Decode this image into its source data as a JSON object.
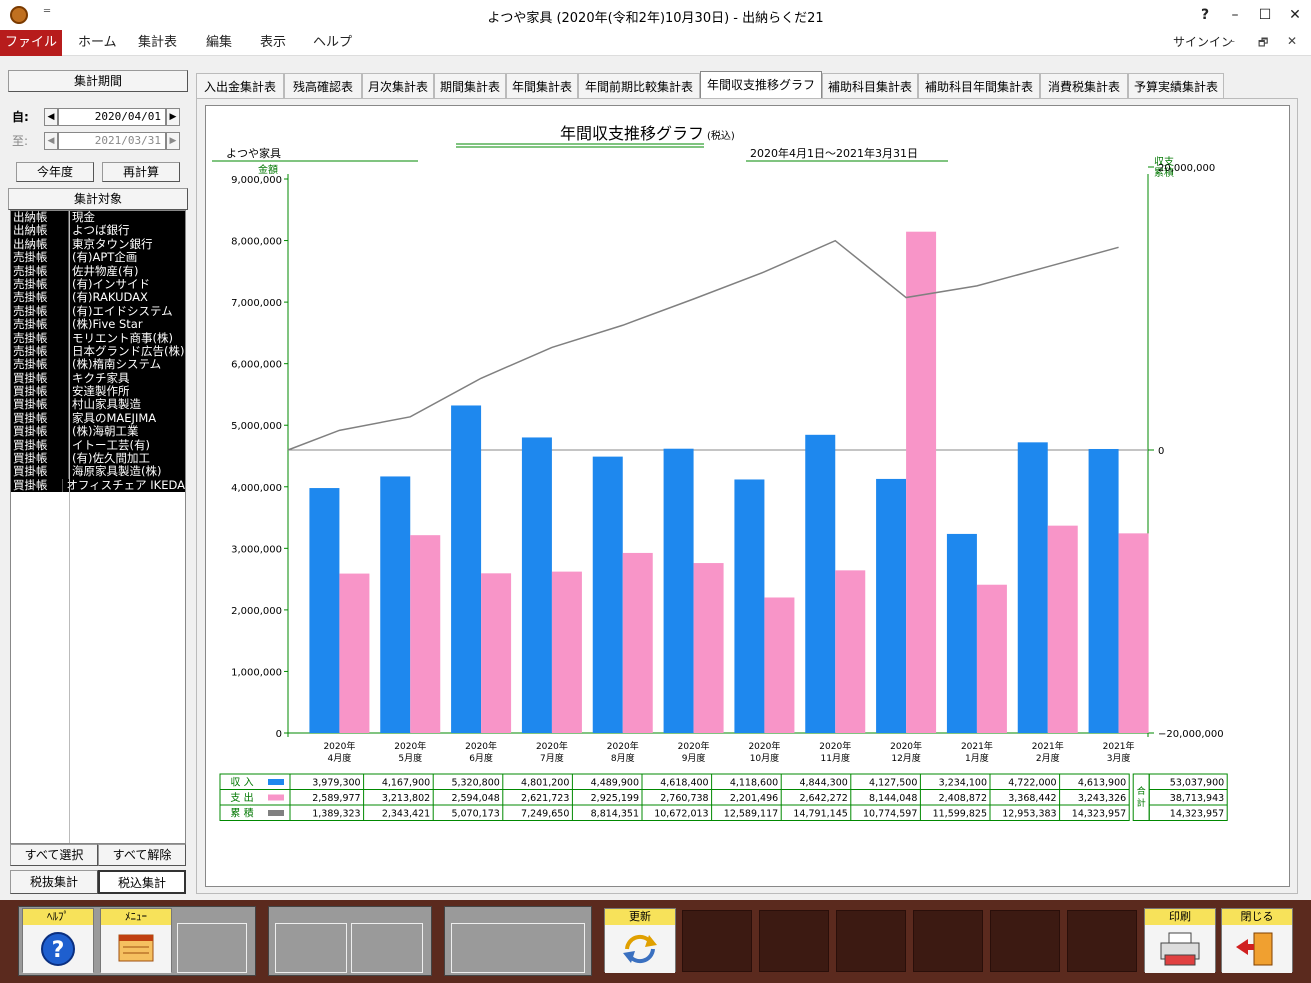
{
  "window": {
    "title": "よつや家具 (2020年(令和2年)10月30日) - 出納らくだ21",
    "qa": "═",
    "help": "?",
    "minimize": "–",
    "maximize": "☐",
    "close": "✕"
  },
  "menu": {
    "file": "ファイル",
    "items": [
      "ホーム",
      "集計表",
      "編集",
      "表示",
      "ヘルプ"
    ],
    "signin": "サインイン",
    "sub_min": "–",
    "sub_restore": "🗗",
    "sub_close": "✕"
  },
  "left": {
    "period_header": "集計期間",
    "from_label": "自:",
    "to_label": "至:",
    "from": "2020/04/01",
    "to": "2021/03/31",
    "this_year": "今年度",
    "recalc": "再計算",
    "target_header": "集計対象",
    "select_all": "すべて選択",
    "deselect_all": "すべて解除",
    "tax_excl": "税抜集計",
    "tax_incl": "税込集計",
    "targets": [
      [
        "出納帳",
        "現金"
      ],
      [
        "出納帳",
        "よつば銀行"
      ],
      [
        "出納帳",
        "東京タウン銀行"
      ],
      [
        "売掛帳",
        "(有)APT企画"
      ],
      [
        "売掛帳",
        "佐井物産(有)"
      ],
      [
        "売掛帳",
        "(有)インサイド"
      ],
      [
        "売掛帳",
        "(有)RAKUDAX"
      ],
      [
        "売掛帳",
        "(有)エイドシステム"
      ],
      [
        "売掛帳",
        "(株)Five Star"
      ],
      [
        "売掛帳",
        "モリエント商事(株)"
      ],
      [
        "売掛帳",
        "日本グランド広告(株)"
      ],
      [
        "売掛帳",
        "(株)楕南システム"
      ],
      [
        "買掛帳",
        "キクチ家具"
      ],
      [
        "買掛帳",
        "安達製作所"
      ],
      [
        "買掛帳",
        "村山家具製造"
      ],
      [
        "買掛帳",
        "家具のMAEJIMA"
      ],
      [
        "買掛帳",
        "(株)海朝工業"
      ],
      [
        "買掛帳",
        "イトー工芸(有)"
      ],
      [
        "買掛帳",
        "(有)佐久間加工"
      ],
      [
        "買掛帳",
        "海原家具製造(株)"
      ],
      [
        "買掛帳",
        "オフィスチェア IKEDA"
      ]
    ]
  },
  "tabs": [
    "入出金集計表",
    "残高確認表",
    "月次集計表",
    "期間集計表",
    "年間集計表",
    "年間前期比較集計表",
    "年間収支推移グラフ",
    "補助科目集計表",
    "補助科目年間集計表",
    "消費税集計表",
    "予算実績集計表"
  ],
  "active_tab": 6,
  "chart_data": {
    "type": "bar",
    "title": "年間収支推移グラフ",
    "title_note": "(税込)",
    "company": "よつや家具",
    "period": "2020年4月1日～2021年3月31日",
    "ylabel_left": "金額",
    "ylabel_right": [
      "収支",
      "累積"
    ],
    "ylim_left": [
      0,
      9000000
    ],
    "ylim_right": [
      -20000000,
      20000000
    ],
    "yticks_left": [
      "0",
      "1,000,000",
      "2,000,000",
      "3,000,000",
      "4,000,000",
      "5,000,000",
      "6,000,000",
      "7,000,000",
      "8,000,000",
      "9,000,000"
    ],
    "yticks_right": [
      "−20,000,000",
      "0",
      "20,000,000"
    ],
    "categories": [
      [
        "2020年",
        "4月度"
      ],
      [
        "2020年",
        "5月度"
      ],
      [
        "2020年",
        "6月度"
      ],
      [
        "2020年",
        "7月度"
      ],
      [
        "2020年",
        "8月度"
      ],
      [
        "2020年",
        "9月度"
      ],
      [
        "2020年",
        "10月度"
      ],
      [
        "2020年",
        "11月度"
      ],
      [
        "2020年",
        "12月度"
      ],
      [
        "2021年",
        "1月度"
      ],
      [
        "2021年",
        "2月度"
      ],
      [
        "2021年",
        "3月度"
      ]
    ],
    "series": [
      {
        "name": "収 入",
        "color": "#1e88ee",
        "values": [
          3979300,
          4167900,
          5320800,
          4801200,
          4489900,
          4618400,
          4118600,
          4844300,
          4127500,
          3234100,
          4722000,
          4613900
        ],
        "total": "53,037,900",
        "labels": [
          "3,979,300",
          "4,167,900",
          "5,320,800",
          "4,801,200",
          "4,489,900",
          "4,618,400",
          "4,118,600",
          "4,844,300",
          "4,127,500",
          "3,234,100",
          "4,722,000",
          "4,613,900"
        ]
      },
      {
        "name": "支 出",
        "color": "#f895c8",
        "values": [
          2589977,
          3213802,
          2594048,
          2621723,
          2925199,
          2760738,
          2201496,
          2642272,
          8144048,
          2408872,
          3368442,
          3243326
        ],
        "total": "38,713,943",
        "labels": [
          "2,589,977",
          "3,213,802",
          "2,594,048",
          "2,621,723",
          "2,925,199",
          "2,760,738",
          "2,201,496",
          "2,642,272",
          "8,144,048",
          "2,408,872",
          "3,368,442",
          "3,243,326"
        ]
      },
      {
        "name": "累 積",
        "color": "#808080",
        "values": [
          1389323,
          2343421,
          5070173,
          7249650,
          8814351,
          10672013,
          12589117,
          14791145,
          10774597,
          11599825,
          12953383,
          14323957
        ],
        "total": "14,323,957",
        "labels": [
          "1,389,323",
          "2,343,421",
          "5,070,173",
          "7,249,650",
          "8,814,351",
          "10,672,013",
          "12,589,117",
          "14,791,145",
          "10,774,597",
          "11,599,825",
          "12,953,383",
          "14,323,957"
        ]
      }
    ],
    "total_label": [
      "合",
      "計"
    ]
  },
  "bottom": {
    "help": "ﾍﾙﾌﾟ",
    "menu": "ﾒﾆｭｰ",
    "refresh": "更新",
    "print": "印刷",
    "close": "閉じる"
  }
}
